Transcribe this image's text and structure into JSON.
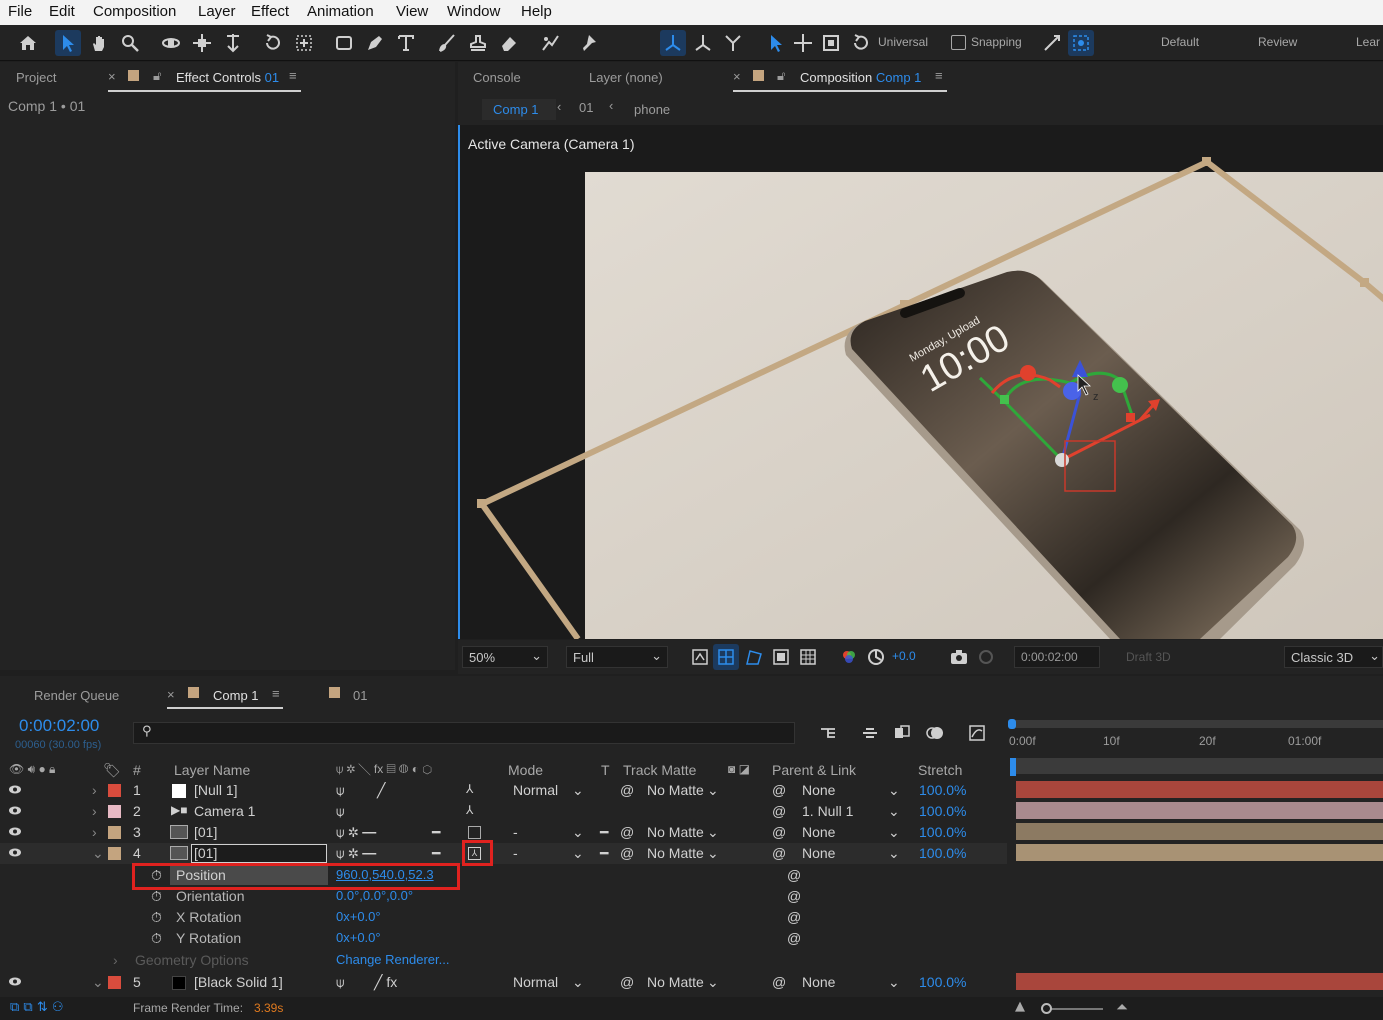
{
  "menu": [
    "File",
    "Edit",
    "Composition",
    "Layer",
    "Effect",
    "Animation",
    "View",
    "Window",
    "Help"
  ],
  "toolbar": {
    "axis_mode": "Universal",
    "snapping": "Snapping",
    "workspaces": [
      "Default",
      "Review",
      "Lear"
    ]
  },
  "left_panel": {
    "tab_project": "Project",
    "tab_effect_controls": "Effect Controls",
    "effect_target": "01",
    "breadcrumb": "Comp 1 • 01"
  },
  "viewer_panel": {
    "tab_console": "Console",
    "tab_layer": "Layer (none)",
    "tab_composition": "Composition",
    "comp_name": "Comp 1",
    "flow": [
      "Comp 1",
      "01",
      "phone"
    ],
    "camera_label": "Active Camera (Camera 1)",
    "phone_screen": {
      "date": "Monday, Upload",
      "time": "10:00",
      "axis_label": "z"
    }
  },
  "viewer_bar": {
    "zoom": "50%",
    "resolution": "Full",
    "exposure": "+0.0",
    "timecode": "0:00:02:00",
    "draft": "Draft 3D",
    "renderer": "Classic 3D"
  },
  "timeline": {
    "tab_render_queue": "Render Queue",
    "tab_comp": "Comp 1",
    "tab_01": "01",
    "timecode": "0:00:02:00",
    "fps": "00060 (30.00 fps)",
    "ruler": [
      "0:00f",
      "10f",
      "20f",
      "01:00f"
    ],
    "columns": {
      "num": "#",
      "layer_name": "Layer Name",
      "mode": "Mode",
      "t": "T",
      "track_matte": "Track Matte",
      "parent": "Parent & Link",
      "stretch": "Stretch"
    },
    "layers": [
      {
        "num": "1",
        "name": "[Null 1]",
        "mode": "Normal",
        "matte": "No Matte",
        "parent": "None",
        "stretch": "100.0%",
        "label_color": "#d94c3d",
        "bar_color": "#a9463c"
      },
      {
        "num": "2",
        "name": "Camera 1",
        "mode": "",
        "matte": "",
        "parent": "1. Null 1",
        "stretch": "100.0%",
        "label_color": "#e7b9c4",
        "bar_color": "#a98a8e"
      },
      {
        "num": "3",
        "name": "[01]",
        "mode": "-",
        "matte": "No Matte",
        "parent": "None",
        "stretch": "100.0%",
        "label_color": "#c4a47f",
        "bar_color": "#8c7a62"
      },
      {
        "num": "4",
        "name": "[01]",
        "mode": "-",
        "matte": "No Matte",
        "parent": "None",
        "stretch": "100.0%",
        "label_color": "#c4a47f",
        "bar_color": "#a89274"
      },
      {
        "num": "5",
        "name": "[Black Solid 1]",
        "mode": "Normal",
        "matte": "No Matte",
        "parent": "None",
        "stretch": "100.0%",
        "label_color": "#d94c3d",
        "bar_color": "#a9463c"
      }
    ],
    "properties": [
      {
        "name": "Position",
        "value": "960.0,540.0,52.3"
      },
      {
        "name": "Orientation",
        "value": "0.0°,0.0°,0.0°"
      },
      {
        "name": "X Rotation",
        "value": "0x+0.0°"
      },
      {
        "name": "Y Rotation",
        "value": "0x+0.0°"
      }
    ],
    "geometry_options": "Geometry Options",
    "change_renderer": "Change Renderer...",
    "frame_render_label": "Frame Render Time:",
    "frame_render_value": "3.39s"
  },
  "colors": {
    "accent": "#2d8ceb",
    "highlight_box": "#e0221f",
    "comp_swatch": "#c4a47f"
  }
}
